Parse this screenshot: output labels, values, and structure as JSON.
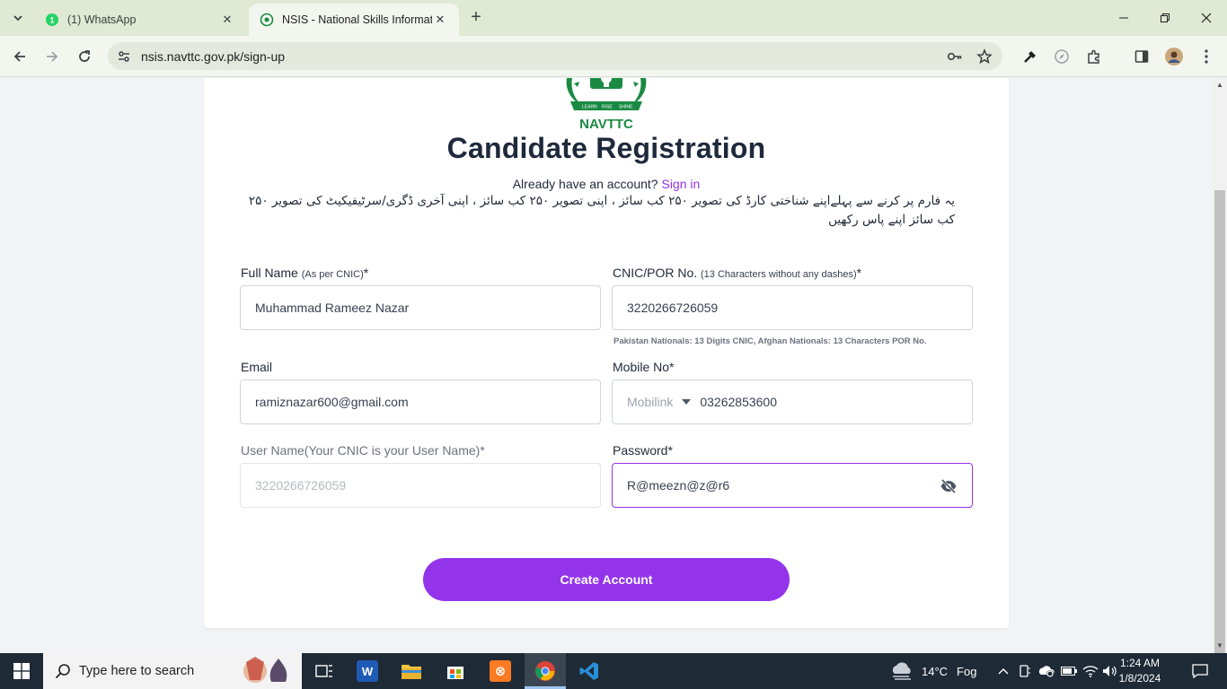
{
  "browser": {
    "tabs": [
      {
        "title": "(1) WhatsApp"
      },
      {
        "title": "NSIS - National Skills Informatic"
      }
    ],
    "url": "nsis.navttc.gov.pk/sign-up"
  },
  "page": {
    "logo_text": "NAVTTC",
    "logo_motto": [
      "LEARN",
      "RISE",
      "SHINE"
    ],
    "heading": "Candidate Registration",
    "signin_prompt": "Already have an account?",
    "signin_link": "Sign in",
    "urdu_note": "یہ فارم پر کرنے سے پہلےاپنے شناختی کارڈ کی تصویر ۲۵۰ کب سائز ، اپنی تصویر ۲۵۰ کب سائز ، اپنی آخری ڈگری/سرٹیفیکیٹ کی تصویر ۲۵۰ کب سائز اپنے پاس رکھیں",
    "fields": {
      "full_name": {
        "label": "Full Name",
        "hint": "(As per CNIC)",
        "required": "*",
        "value": "Muhammad Rameez Nazar"
      },
      "cnic": {
        "label": "CNIC/POR No.",
        "hint": "(13 Characters without any dashes)",
        "required": "*",
        "value": "3220266726059",
        "helper": "Pakistan Nationals: 13 Digits CNIC, Afghan Nationals: 13 Characters POR No."
      },
      "email": {
        "label": "Email",
        "value": "ramiznazar600@gmail.com"
      },
      "mobile": {
        "label": "Mobile No",
        "required": "*",
        "carrier": "Mobilink",
        "value": "03262853600"
      },
      "username": {
        "label": "User Name(Your CNIC is your User Name)",
        "required": "*",
        "placeholder": "3220266726059"
      },
      "password": {
        "label": "Password",
        "required": "*",
        "value": "R@meezn@z@r6"
      }
    },
    "submit_label": "Create Account"
  },
  "taskbar": {
    "search_placeholder": "Type here to search",
    "weather_temp": "14°C",
    "weather_text": "Fog",
    "time": "1:24 AM",
    "date": "1/8/2024"
  },
  "colors": {
    "accent": "#9333ea",
    "heading": "#1e293b",
    "logo_green": "#1a8a43",
    "tab_strip": "#dfe9d3",
    "taskbar": "#1e2a36"
  }
}
